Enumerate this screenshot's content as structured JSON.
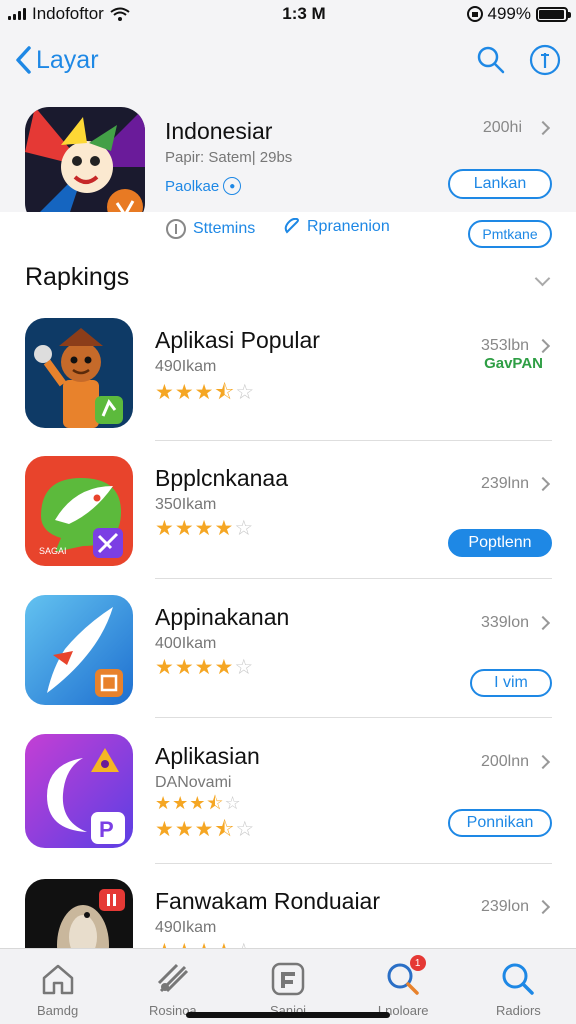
{
  "status_bar": {
    "carrier": "Indofoftor",
    "time": "1:3 M",
    "battery_text": "499%",
    "battery_level": 0.95
  },
  "nav": {
    "back_label": "Layar",
    "icons": [
      "search-icon",
      "info-icon"
    ]
  },
  "featured": {
    "name": "Indonesiar",
    "subtitle": "Papir: Satem| 29bs",
    "tag": "Paolkae",
    "size": "200hi",
    "button": "Lankan",
    "info_left": "Sttemins",
    "info_mid": "Rpranenion",
    "info_button": "Pmtkane"
  },
  "section": {
    "title": "Rapkings"
  },
  "apps": [
    {
      "title": "Aplikasi Popular",
      "subtitle": "490Ikam",
      "rating": 3.5,
      "size": "353lbn",
      "extra": "GavPAN",
      "button": "",
      "button_style": "none",
      "icon": "cartoon-character-icon",
      "colors": [
        "#0e3a66",
        "#e8822c"
      ]
    },
    {
      "title": "Bpplcnkanaa",
      "subtitle": "350Ikam",
      "rating": 4,
      "size": "239lnn",
      "extra": "",
      "button": "Poptlenn",
      "button_style": "filled",
      "icon": "chat-bubble-icon",
      "colors": [
        "#e8442c",
        "#5cba3c"
      ]
    },
    {
      "title": "Appinakanan",
      "subtitle": "400Ikam",
      "rating": 4,
      "size": "339lon",
      "extra": "",
      "button": "I vim",
      "button_style": "outline",
      "icon": "compass-needle-icon",
      "colors": [
        "#1e88e5",
        "#63c2f0"
      ]
    },
    {
      "title": "Aplikasian",
      "subtitle": "DANovami",
      "rating": 3.5,
      "size": "200lnn",
      "extra": "",
      "button": "Ponnikan",
      "button_style": "outline",
      "icon": "crescent-moon-icon",
      "colors": [
        "#7b3fe4",
        "#c43fd4"
      ]
    },
    {
      "title": "Fanwakam Ronduaiar",
      "subtitle": "490Ikam",
      "rating": 4,
      "size": "239lon",
      "extra": "",
      "button": "",
      "button_style": "none",
      "icon": "animal-photo-icon",
      "colors": [
        "#111111",
        "#c9b79c"
      ]
    }
  ],
  "tabs": [
    {
      "label": "Bamdg",
      "icon": "home-icon"
    },
    {
      "label": "Rosinoa",
      "icon": "tools-icon"
    },
    {
      "label": "Sanioi",
      "icon": "apps-icon"
    },
    {
      "label": "Lnoloare",
      "icon": "search-badge-icon",
      "badge": "1"
    },
    {
      "label": "Radiors",
      "icon": "search-icon"
    }
  ]
}
